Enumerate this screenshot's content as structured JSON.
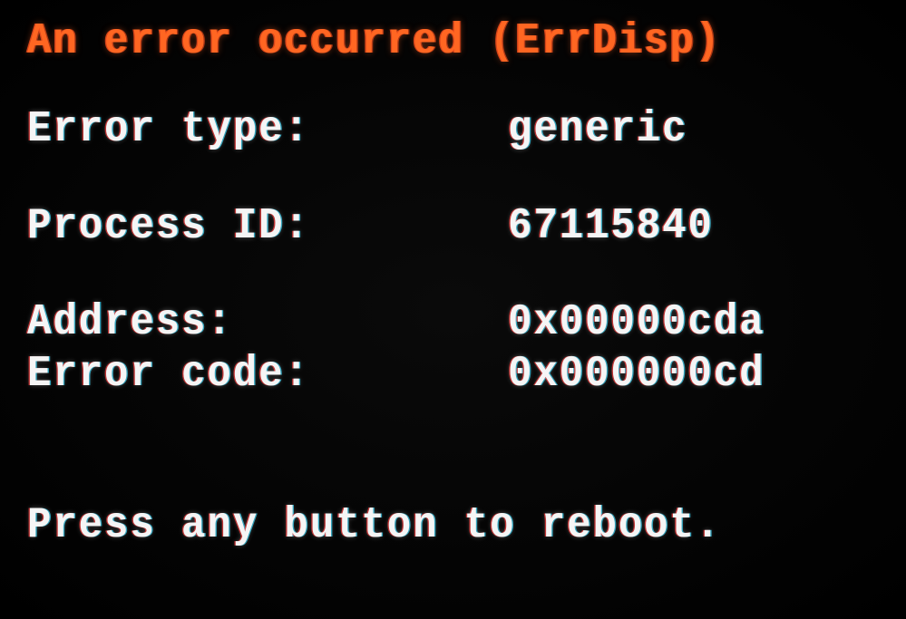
{
  "title": "An error occurred (ErrDisp)",
  "fields": {
    "error_type": {
      "label": "Error type:",
      "value": "generic"
    },
    "process_id": {
      "label": "Process ID:",
      "value": "67115840"
    },
    "address": {
      "label": "Address:",
      "value": "0x00000cda"
    },
    "error_code": {
      "label": "Error code:",
      "value": "0x000000cd"
    }
  },
  "footer": "Press any button to reboot.",
  "colors": {
    "title": "#ff6622",
    "text": "#f5f5f5",
    "background": "#000000"
  }
}
